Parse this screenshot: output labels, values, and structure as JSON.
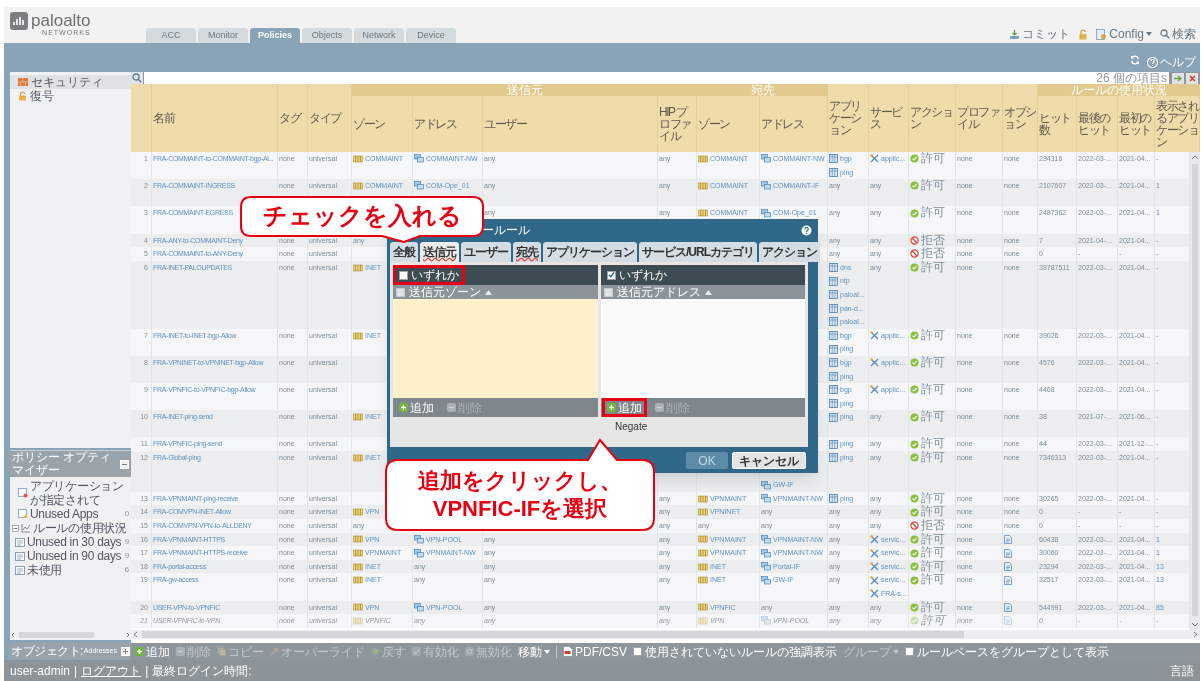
{
  "app": {
    "logo": "paloalto",
    "logo_sub": "NETWORKS",
    "tabs": [
      {
        "label": "ACC",
        "selected": false
      },
      {
        "label": "Monitor",
        "selected": false
      },
      {
        "label": "Policies",
        "selected": true
      },
      {
        "label": "Objects",
        "selected": false
      },
      {
        "label": "Network",
        "selected": false
      },
      {
        "label": "Device",
        "selected": false
      }
    ],
    "actions": [
      {
        "kind": "commit",
        "label": "コミット"
      },
      {
        "kind": "lock"
      },
      {
        "kind": "config",
        "label": "Config"
      },
      {
        "kind": "search",
        "label": "検索"
      }
    ],
    "help": "ヘルプ"
  },
  "sidebar": {
    "rulebases": [
      {
        "kind": "security",
        "label": "セキュリティ",
        "selected": true
      },
      {
        "kind": "decryption",
        "label": "復号",
        "selected": false
      }
    ],
    "optimizer": {
      "title": "ポリシー オプティマイザー",
      "items": [
        {
          "kind": "no-app",
          "label": "アプリケーションが指定されて"
        },
        {
          "kind": "unused-apps",
          "label": "Unused Apps",
          "count": "0"
        },
        {
          "kind": "usage",
          "label": "ルールの使用状況",
          "expanded": true,
          "children": [
            {
              "kind": "list",
              "label": "Unused in 30 days",
              "count": "9"
            },
            {
              "kind": "list",
              "label": "Unused in 90 days",
              "count": "9"
            },
            {
              "kind": "list",
              "label": "未使用",
              "count": "6"
            }
          ]
        }
      ]
    },
    "objects": {
      "title": "オブジェクト:",
      "value": "Addresses"
    }
  },
  "filter": {
    "count": "26 個の項目s"
  },
  "table": {
    "columns": [
      {
        "grouped": false
      },
      {
        "label": "名前",
        "grouped": false
      },
      {
        "label": "タグ",
        "grouped": false
      },
      {
        "label": "タイプ",
        "grouped": false
      },
      {
        "label": "ゾーン",
        "group": "送信元",
        "grouped": false
      },
      {
        "label": "アドレス",
        "grouped": true
      },
      {
        "label": "ユーザー",
        "grouped": true
      },
      {
        "label": "HIP プロファイル",
        "grouped": true
      },
      {
        "label": "ゾーン",
        "group": "宛先",
        "grouped": false
      },
      {
        "label": "アドレス",
        "grouped": true
      },
      {
        "label": "アプリケーション",
        "grouped": false
      },
      {
        "label": "サービス",
        "grouped": false
      },
      {
        "label": "アクション",
        "grouped": false
      },
      {
        "label": "プロファイル",
        "grouped": false
      },
      {
        "label": "オプション",
        "grouped": false
      },
      {
        "label": "ヒット数",
        "group": "ルールの使用状況",
        "grouped": false
      },
      {
        "label": "最後のヒット",
        "grouped": true
      },
      {
        "label": "最初のヒット",
        "grouped": true
      },
      {
        "label": "表示されるアプリケーション",
        "grouped": true
      }
    ],
    "rows": [
      {
        "disabled": false,
        "cells": [
          "1",
          "FRA-COMMAINT-to-COMMAINT-bgp-Al...",
          "none",
          "universal",
          [
            {
              "kind": "zone",
              "text": "COMMAINT"
            }
          ],
          [
            {
              "kind": "address",
              "text": "COMMAINT-NW"
            }
          ],
          "any",
          "any",
          [
            {
              "kind": "zone",
              "text": "COMMAINT"
            }
          ],
          [
            {
              "kind": "address",
              "text": "COMMAINT-NW"
            }
          ],
          [
            {
              "kind": "app",
              "text": "bgp"
            },
            {
              "kind": "app",
              "text": "ping"
            }
          ],
          [
            {
              "kind": "service",
              "text": "applic..."
            }
          ],
          [
            {
              "kind": "allow",
              "text": "許可"
            }
          ],
          "none",
          "none",
          "234316",
          "2022-03-...",
          "2021-04...",
          "-"
        ]
      },
      {
        "disabled": false,
        "cells": [
          "2",
          "FRA-COMMAINT-INGRESS",
          "none",
          "universal",
          [
            {
              "kind": "zone",
              "text": "COMMAINT"
            }
          ],
          [
            {
              "kind": "address",
              "text": "COM-Ope_01"
            },
            null
          ],
          "any",
          "any",
          [
            {
              "kind": "zone",
              "text": "COMMAINT"
            }
          ],
          [
            {
              "kind": "address",
              "text": "COMMAINT-IF"
            }
          ],
          "any",
          "any",
          [
            {
              "kind": "allow",
              "text": "許可"
            }
          ],
          "none",
          "none",
          "2107607",
          "2022-03-...",
          "2021-04...",
          [
            {
              "kind": "link",
              "text": "1"
            }
          ]
        ]
      },
      {
        "disabled": false,
        "cells": [
          "3",
          "FRA-COMMAINT-EGRESS",
          null,
          null,
          null,
          null,
          "any",
          "any",
          [
            {
              "kind": "zone",
              "text": "COMMAINT"
            }
          ],
          [
            {
              "kind": "address",
              "text": "COM-Ope_01"
            },
            null
          ],
          "any",
          "any",
          [
            {
              "kind": "allow",
              "text": "許可"
            }
          ],
          "none",
          "none",
          "2487362",
          "2022-03-...",
          "2021-04...",
          [
            {
              "kind": "link",
              "text": "1"
            }
          ]
        ]
      },
      {
        "disabled": false,
        "cells": [
          "4",
          "FRA-ANY-to-COMMAINT-Deny",
          "none",
          "universal",
          "any",
          null,
          null,
          null,
          null,
          null,
          "any",
          "any",
          [
            {
              "kind": "deny",
              "text": "拒否"
            }
          ],
          "none",
          "none",
          "7",
          "2021-04-...",
          "2021-04...",
          "-"
        ]
      },
      {
        "disabled": false,
        "cells": [
          "5",
          "FRA-COMMAINT-to-ANY-Deny",
          "none",
          "universal",
          null,
          null,
          null,
          null,
          null,
          null,
          "any",
          "any",
          [
            {
              "kind": "deny",
              "text": "拒否"
            }
          ],
          "none",
          "none",
          "0",
          "-",
          "-",
          "-"
        ]
      },
      {
        "disabled": false,
        "cells": [
          "6",
          "FRA-INET-PALOUPDATES",
          "none",
          "universal",
          [
            {
              "kind": "zone",
              "text": "INET"
            }
          ],
          null,
          null,
          null,
          null,
          null,
          [
            {
              "kind": "app",
              "text": "dns"
            },
            {
              "kind": "app",
              "text": "ntp"
            },
            {
              "kind": "app",
              "text": "paloal..."
            },
            {
              "kind": "app",
              "text": "pan-d..."
            },
            {
              "kind": "app",
              "text": "paloal..."
            }
          ],
          "any",
          [
            {
              "kind": "allow",
              "text": "許可"
            }
          ],
          "none",
          "none",
          "38787511",
          "2022-03-...",
          "2021-04...",
          "-"
        ]
      },
      {
        "disabled": false,
        "cells": [
          "7",
          "FRA-INET-to-INET-bgp-Allow",
          "none",
          "universal",
          [
            {
              "kind": "zone",
              "text": "INET"
            }
          ],
          null,
          null,
          null,
          null,
          null,
          [
            {
              "kind": "app",
              "text": "bgp"
            },
            {
              "kind": "app",
              "text": "ping"
            }
          ],
          [
            {
              "kind": "service",
              "text": "applic..."
            }
          ],
          [
            {
              "kind": "allow",
              "text": "許可"
            }
          ],
          "none",
          "none",
          "39026",
          "2022-03-...",
          "2021-04...",
          "-"
        ]
      },
      {
        "disabled": false,
        "cells": [
          "8",
          "FRA-VPNINET-to-VPNINET-bgp-Allow",
          "none",
          "universal",
          null,
          null,
          null,
          null,
          null,
          null,
          [
            {
              "kind": "app",
              "text": "bgp"
            },
            {
              "kind": "app",
              "text": "ping"
            }
          ],
          [
            {
              "kind": "service",
              "text": "applic..."
            }
          ],
          [
            {
              "kind": "allow",
              "text": "許可"
            }
          ],
          "none",
          "none",
          "4576",
          "2022-03-...",
          "2021-04...",
          "-"
        ]
      },
      {
        "disabled": false,
        "cells": [
          "9",
          "FRA-VPNFIC-to-VPNFIC-bgp-Allow",
          "none",
          "universal",
          null,
          null,
          null,
          null,
          null,
          null,
          [
            {
              "kind": "app",
              "text": "bgp"
            },
            {
              "kind": "app",
              "text": "ping"
            }
          ],
          [
            {
              "kind": "service",
              "text": "applic..."
            }
          ],
          [
            {
              "kind": "allow",
              "text": "許可"
            }
          ],
          "none",
          "none",
          "4468",
          "2022-03-...",
          "2021-04...",
          "-"
        ]
      },
      {
        "disabled": false,
        "cells": [
          "10",
          "FRA-INET-ping-send",
          "none",
          "universal",
          [
            {
              "kind": "zone",
              "text": "INET"
            }
          ],
          [
            null,
            null
          ],
          null,
          null,
          null,
          null,
          [
            {
              "kind": "app",
              "text": "ping"
            }
          ],
          "any",
          [
            {
              "kind": "allow",
              "text": "許可"
            }
          ],
          "none",
          "none",
          "38",
          "2021-07-...",
          "2021-06...",
          "-"
        ]
      },
      {
        "disabled": false,
        "cells": [
          "11",
          "FRA-VPNFIC-ping-send",
          "none",
          "universal",
          null,
          null,
          null,
          null,
          null,
          null,
          [
            {
              "kind": "app",
              "text": "ping"
            }
          ],
          "any",
          [
            {
              "kind": "allow",
              "text": "許可"
            }
          ],
          "none",
          "none",
          "44",
          "2022-03-...",
          "2021-12-...",
          "-"
        ]
      },
      {
        "disabled": false,
        "cells": [
          "12",
          "FRA-Global-ping",
          "none",
          "universal",
          [
            {
              "kind": "zone",
              "text": "INET"
            }
          ],
          null,
          null,
          null,
          null,
          [
            null,
            null,
            {
              "kind": "address",
              "text": "GW-IF"
            }
          ],
          [
            {
              "kind": "app",
              "text": "ping"
            }
          ],
          "any",
          [
            {
              "kind": "allow",
              "text": "許可"
            }
          ],
          "none",
          "none",
          "7346313",
          "2022-03-...",
          "2021-04...",
          "-"
        ]
      },
      {
        "disabled": false,
        "cells": [
          "13",
          "FRA-VPNMAINT-ping-receive",
          "none",
          "universal",
          null,
          null,
          null,
          "any",
          [
            {
              "kind": "zone",
              "text": "VPNMAINT"
            }
          ],
          [
            {
              "kind": "address",
              "text": "VPNMAINT-NW"
            }
          ],
          [
            {
              "kind": "app",
              "text": "ping"
            }
          ],
          "any",
          [
            {
              "kind": "allow",
              "text": "許可"
            }
          ],
          "none",
          "none",
          "30265",
          "2022-03-...",
          "2021-04...",
          "-"
        ]
      },
      {
        "disabled": false,
        "cells": [
          "14",
          "FRA-COMVPN-INET-Allow",
          "none",
          "universal",
          [
            {
              "kind": "zone",
              "text": "VPN"
            }
          ],
          null,
          null,
          "any",
          [
            {
              "kind": "zone",
              "text": "VPNINET"
            }
          ],
          "any",
          "any",
          "any",
          [
            {
              "kind": "allow",
              "text": "許可"
            }
          ],
          "none",
          "none",
          "0",
          "-",
          "-",
          "-"
        ]
      },
      {
        "disabled": false,
        "cells": [
          "15",
          "FRA-COMVPN-VPN-to-ALLDENY",
          "none",
          "universal",
          "any",
          null,
          null,
          "any",
          "any",
          "any",
          "any",
          "any",
          [
            {
              "kind": "deny",
              "text": "拒否"
            }
          ],
          "none",
          "none",
          "0",
          "-",
          "-",
          "-"
        ]
      },
      {
        "disabled": false,
        "cells": [
          "16",
          "FRA-VPNMAINT-HTTPS",
          "none",
          "universal",
          [
            {
              "kind": "zone",
              "text": "VPN"
            }
          ],
          [
            {
              "kind": "address",
              "text": "VPN-POOL"
            }
          ],
          "any",
          "any",
          [
            {
              "kind": "zone",
              "text": "VPNMAINT"
            }
          ],
          [
            {
              "kind": "address",
              "text": "VPNMAINT-NW"
            }
          ],
          "any",
          [
            {
              "kind": "service",
              "text": "servic..."
            }
          ],
          [
            {
              "kind": "allow",
              "text": "許可"
            }
          ],
          "none",
          [
            {
              "kind": "log"
            }
          ],
          "60438",
          "2022-03-...",
          "2021-04...",
          [
            {
              "kind": "link",
              "text": "1"
            }
          ]
        ]
      },
      {
        "disabled": false,
        "cells": [
          "17",
          "FRA-VPNMAINT-HTTPS-receive",
          "none",
          "universal",
          [
            {
              "kind": "zone",
              "text": "VPNMAINT"
            }
          ],
          [
            {
              "kind": "address",
              "text": "VPNMAINT-NW"
            }
          ],
          "any",
          "any",
          [
            {
              "kind": "zone",
              "text": "VPNMAINT"
            }
          ],
          [
            {
              "kind": "address",
              "text": "VPNMAINT-NW"
            }
          ],
          "any",
          [
            {
              "kind": "service",
              "text": "servic..."
            }
          ],
          [
            {
              "kind": "allow",
              "text": "許可"
            }
          ],
          "none",
          [
            {
              "kind": "log"
            }
          ],
          "30060",
          "2022-03-...",
          "2021-04...",
          [
            {
              "kind": "link",
              "text": "1"
            }
          ]
        ]
      },
      {
        "disabled": false,
        "cells": [
          "18",
          "FRA-portal-access",
          "none",
          "universal",
          [
            {
              "kind": "zone",
              "text": "INET"
            }
          ],
          "any",
          "any",
          "any",
          [
            {
              "kind": "zone",
              "text": "INET"
            }
          ],
          [
            {
              "kind": "address",
              "text": "Portal-IF"
            }
          ],
          "any",
          [
            {
              "kind": "service",
              "text": "servic..."
            }
          ],
          [
            {
              "kind": "allow",
              "text": "許可"
            }
          ],
          "none",
          [
            {
              "kind": "log"
            }
          ],
          "23294",
          "2022-03-...",
          "2021-04...",
          [
            {
              "kind": "link",
              "text": "13"
            }
          ]
        ]
      },
      {
        "disabled": false,
        "cells": [
          "19",
          "FRA-gw-access",
          "none",
          "universal",
          [
            {
              "kind": "zone",
              "text": "INET"
            }
          ],
          "any",
          "any",
          "any",
          [
            {
              "kind": "zone",
              "text": "INET"
            }
          ],
          [
            {
              "kind": "address",
              "text": "GW-IF"
            }
          ],
          "any",
          [
            {
              "kind": "service",
              "text": "servic..."
            },
            {
              "kind": "service",
              "text": "FRA-s..."
            }
          ],
          [
            {
              "kind": "allow",
              "text": "許可"
            }
          ],
          "none",
          [
            {
              "kind": "log"
            }
          ],
          "32517",
          "2022-03-...",
          "2021-04...",
          [
            {
              "kind": "link",
              "text": "13"
            }
          ]
        ]
      },
      {
        "disabled": false,
        "cells": [
          "20",
          "USER-VPN-to-VPNFIC",
          "none",
          "universal",
          [
            {
              "kind": "zone",
              "text": "VPN"
            }
          ],
          [
            {
              "kind": "address",
              "text": "VPN-POOL"
            }
          ],
          "any",
          "any",
          [
            {
              "kind": "zone",
              "text": "VPNFIC"
            }
          ],
          "any",
          "any",
          "any",
          [
            {
              "kind": "allow",
              "text": "許可"
            }
          ],
          "none",
          [
            {
              "kind": "log"
            }
          ],
          "544991",
          "2022-03-...",
          "2021-04...",
          [
            {
              "kind": "link",
              "text": "85"
            }
          ]
        ]
      },
      {
        "disabled": true,
        "cells": [
          "21",
          "USER-VPNFIC-to-VPN",
          "none",
          "universal",
          [
            {
              "kind": "zone",
              "text": "VPNFIC"
            }
          ],
          "any",
          "any",
          "any",
          [
            {
              "kind": "zone",
              "text": "VPN"
            }
          ],
          [
            {
              "kind": "address",
              "text": "VPN-POOL"
            }
          ],
          "any",
          "any",
          [
            {
              "kind": "allow",
              "text": "許可"
            }
          ],
          "none",
          [
            {
              "kind": "log"
            }
          ],
          "0",
          "-",
          "-",
          "-"
        ]
      }
    ]
  },
  "toolbar": [
    {
      "kind": "add",
      "label": "追加",
      "disabled": false
    },
    {
      "kind": "delete",
      "label": "削除",
      "disabled": true
    },
    {
      "kind": "copy",
      "label": "コピー",
      "disabled": true
    },
    {
      "kind": "override",
      "label": "オーバーライド",
      "disabled": true
    },
    {
      "kind": "revert",
      "label": "戻す",
      "disabled": true
    },
    {
      "kind": "enable",
      "label": "有効化",
      "disabled": true
    },
    {
      "kind": "disable",
      "label": "無効化",
      "disabled": true
    },
    {
      "kind": "menu",
      "label": "移動",
      "disabled": false
    },
    {
      "kind": "export",
      "label": "PDF/CSV",
      "disabled": false
    },
    {
      "kind": "checkbox",
      "label": "使用されていないルールの強調表示",
      "checked": false
    },
    {
      "kind": "menu",
      "label": "グループ",
      "disabled": true
    },
    {
      "kind": "checkbox",
      "label": "ルールベースをグループとして表示",
      "checked": false
    }
  ],
  "footer": {
    "items": [
      {
        "kind": "text",
        "text": "user-admin"
      },
      {
        "kind": "sep",
        "text": "|"
      },
      {
        "kind": "link",
        "text": "ログアウト"
      },
      {
        "kind": "sep",
        "text": "|"
      },
      {
        "kind": "text",
        "text": "最終ログイン時間:"
      }
    ],
    "language": "言語"
  },
  "dialog": {
    "title": "ールール",
    "tabs": [
      {
        "label": "全般",
        "selected": false,
        "error": false
      },
      {
        "label": "送信元",
        "selected": true,
        "error": true
      },
      {
        "label": "ユーザー",
        "selected": false,
        "error": false
      },
      {
        "label": "宛先",
        "selected": false,
        "error": true
      },
      {
        "label": "アプリケーション",
        "selected": false,
        "error": false
      },
      {
        "label": "サービス/URLカテゴリ",
        "selected": false,
        "error": false
      },
      {
        "label": "アクション",
        "selected": false,
        "error": false
      }
    ],
    "lists": [
      {
        "any_label": "いずれか",
        "any_checked": false,
        "highlighted": true,
        "column": "送信元ゾーン",
        "column_checked": false,
        "buttons": [
          {
            "kind": "add",
            "label": "追加",
            "disabled": false,
            "highlighted": false
          },
          {
            "kind": "delete",
            "label": "削除",
            "disabled": true,
            "highlighted": false
          }
        ]
      },
      {
        "any_label": "いずれか",
        "any_checked": true,
        "highlighted": false,
        "column": "送信元アドレス",
        "column_checked": false,
        "buttons": [
          {
            "kind": "add",
            "label": "追加",
            "disabled": false,
            "highlighted": true
          },
          {
            "kind": "delete",
            "label": "削除",
            "disabled": true,
            "highlighted": false
          }
        ],
        "negate": "Negate"
      }
    ],
    "buttons": [
      {
        "label": "OK",
        "disabled": true
      },
      {
        "label": "キャンセル",
        "disabled": false
      }
    ]
  },
  "callouts": [
    {
      "text": "チェックを入れる"
    },
    {
      "text": "追加をクリックし、\nVPNFIC-IFを選択"
    }
  ]
}
